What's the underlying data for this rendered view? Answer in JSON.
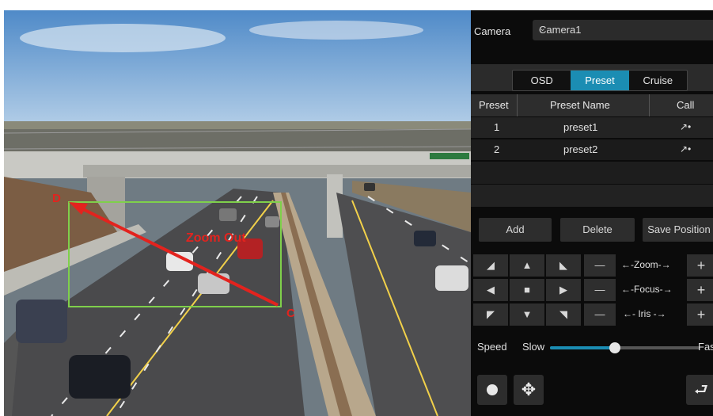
{
  "video": {
    "point_d": "D",
    "point_c": "C",
    "action_label": "Zoom Out",
    "annotation_color": "#e3231e",
    "box_color": "#7fd04b"
  },
  "panel": {
    "camera_label": "Camera",
    "camera_value": "Camera1",
    "tabs": [
      {
        "label": "OSD",
        "active": false
      },
      {
        "label": "Preset",
        "active": true
      },
      {
        "label": "Cruise",
        "active": false
      }
    ],
    "table": {
      "headers": [
        "Preset",
        "Preset Name",
        "Call"
      ],
      "rows": [
        {
          "preset": "1",
          "name": "preset1",
          "call_icon": "call-preset-icon"
        },
        {
          "preset": "2",
          "name": "preset2",
          "call_icon": "call-preset-icon"
        }
      ]
    },
    "buttons": {
      "add": "Add",
      "delete": "Delete",
      "save_position": "Save Position"
    },
    "ptz": {
      "zoom": "←-Zoom-→",
      "focus": "←-Focus-→",
      "iris": "←- Iris -→",
      "minus": "—",
      "plus": "+"
    },
    "speed": {
      "label": "Speed",
      "slow": "Slow",
      "fast": "Fast",
      "value": 0.43
    },
    "accent": "#1b8db3"
  }
}
